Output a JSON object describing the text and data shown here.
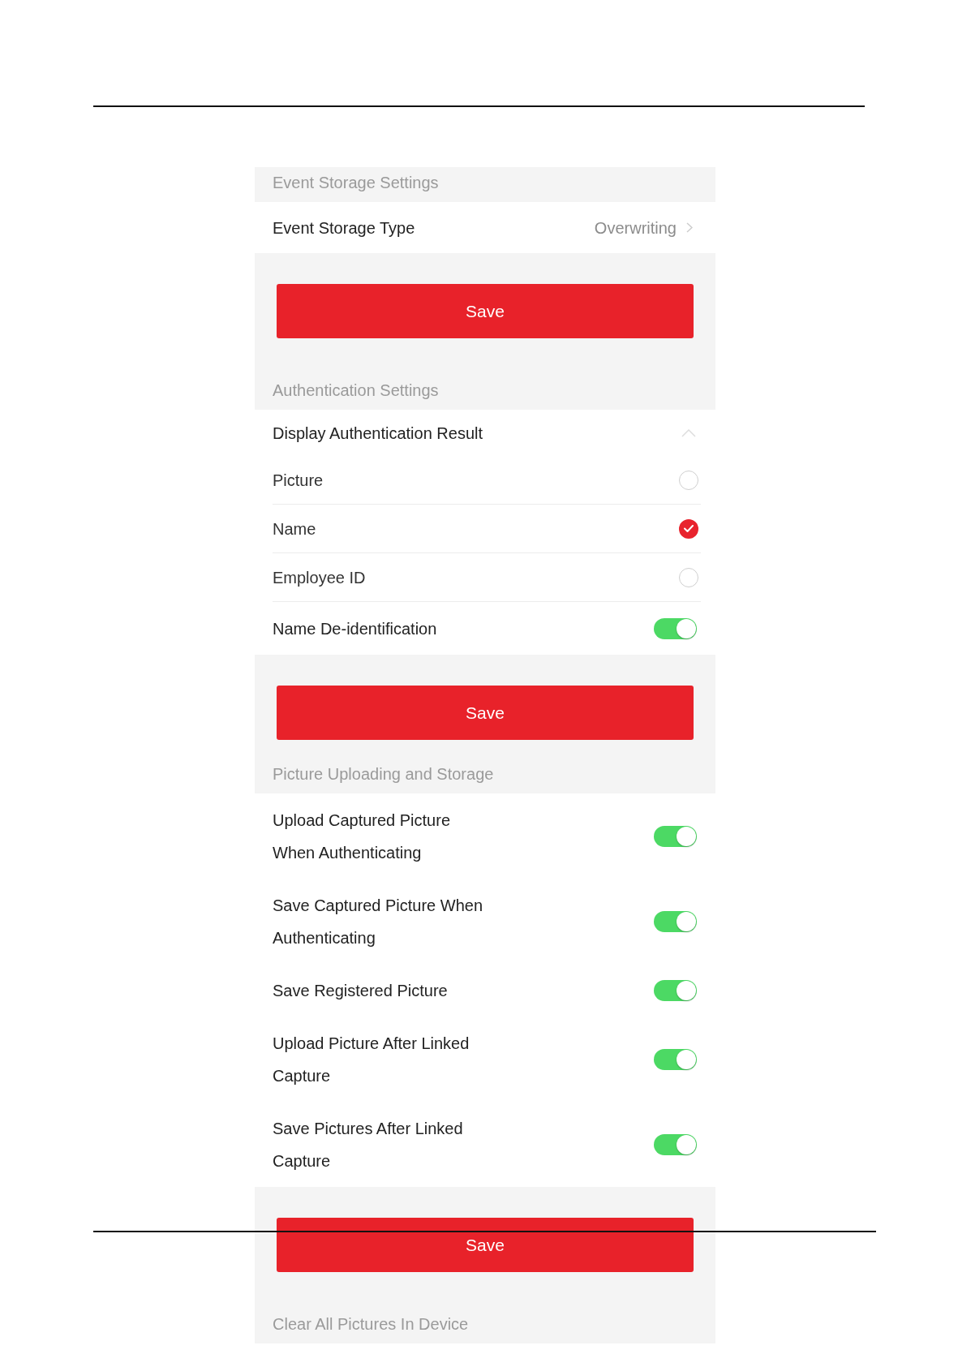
{
  "sections": [
    {
      "title": "Event Storage Settings",
      "rows": [
        {
          "kind": "select",
          "label": "Event Storage Type",
          "value": "Overwriting"
        }
      ],
      "save_button": "Save"
    },
    {
      "title": "Authentication Settings",
      "rows": [
        {
          "kind": "group",
          "label": "Display Authentication Result",
          "expanded": true,
          "options": [
            {
              "label": "Picture",
              "checked": false
            },
            {
              "label": "Name",
              "checked": true
            },
            {
              "label": "Employee ID",
              "checked": false
            }
          ]
        },
        {
          "kind": "toggle",
          "label": "Name De-identification",
          "on": true
        }
      ],
      "save_button": "Save"
    },
    {
      "title": "Picture Uploading and Storage",
      "rows": [
        {
          "kind": "toggle",
          "label": "Upload Captured Picture When Authenticating",
          "on": true
        },
        {
          "kind": "toggle",
          "label": "Save Captured Picture When Authenticating",
          "on": true
        },
        {
          "kind": "toggle",
          "label": "Save Registered Picture",
          "on": true
        },
        {
          "kind": "toggle",
          "label": "Upload Picture After Linked Capture",
          "on": true
        },
        {
          "kind": "toggle",
          "label": "Save Pictures After Linked Capture",
          "on": true
        }
      ],
      "save_button": "Save"
    },
    {
      "title": "Clear All Pictures In Device"
    }
  ]
}
